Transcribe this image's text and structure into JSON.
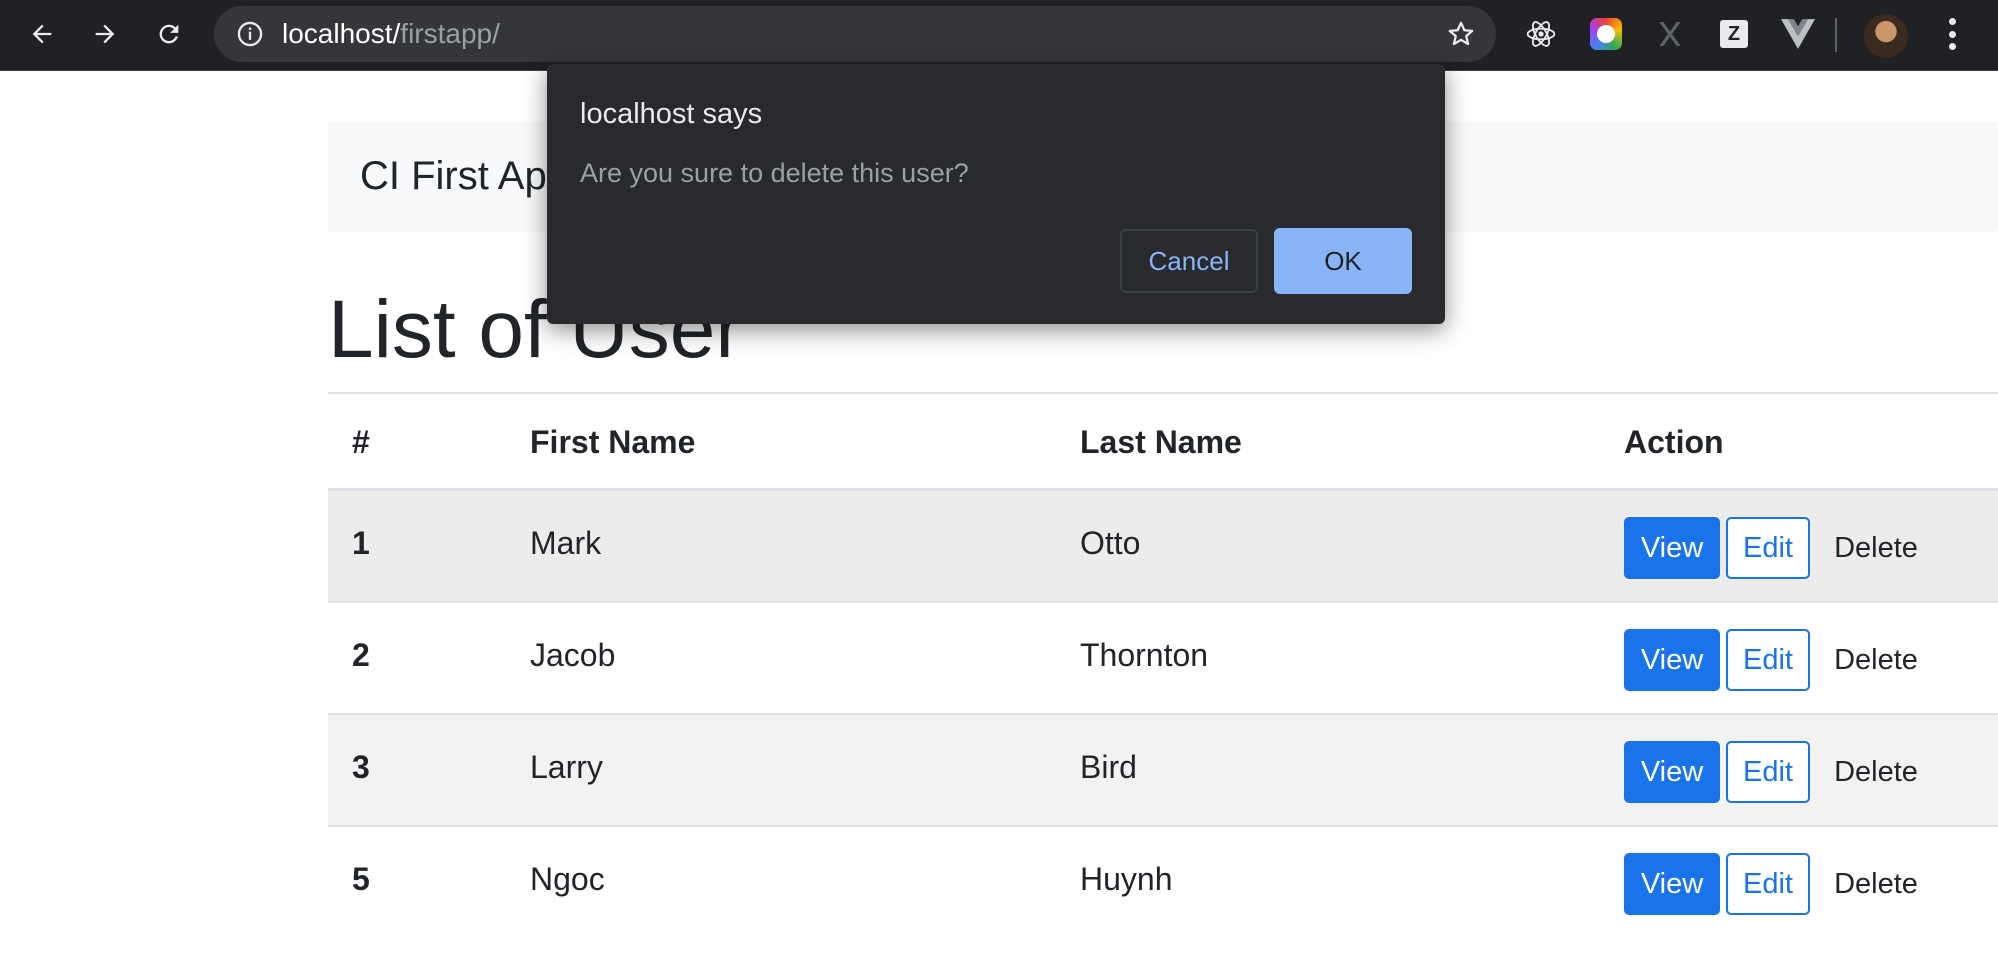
{
  "browser": {
    "url_host": "localhost/",
    "url_path": "firstapp/"
  },
  "navbar": {
    "brand": "CI First Ap"
  },
  "page_title": "List of User",
  "table": {
    "headers": [
      "#",
      "First Name",
      "Last Name",
      "Action"
    ],
    "rows": [
      {
        "id": "1",
        "first": "Mark",
        "last": "Otto"
      },
      {
        "id": "2",
        "first": "Jacob",
        "last": "Thornton"
      },
      {
        "id": "3",
        "first": "Larry",
        "last": "Bird"
      },
      {
        "id": "5",
        "first": "Ngoc",
        "last": "Huynh"
      }
    ],
    "actions": {
      "view": "View",
      "edit": "Edit",
      "delete": "Delete"
    }
  },
  "dialog": {
    "title": "localhost says",
    "message": "Are you sure to delete this user?",
    "cancel_label": "Cancel",
    "ok_label": "OK"
  },
  "extensions": [
    "react-devtools-icon",
    "color-picker-icon",
    "x-extension-icon",
    "z-extension-icon",
    "vue-devtools-icon"
  ],
  "colors": {
    "primary": "#1a73e8",
    "dialog_bg": "#292a2d",
    "dialog_accent": "#8ab4f8"
  }
}
